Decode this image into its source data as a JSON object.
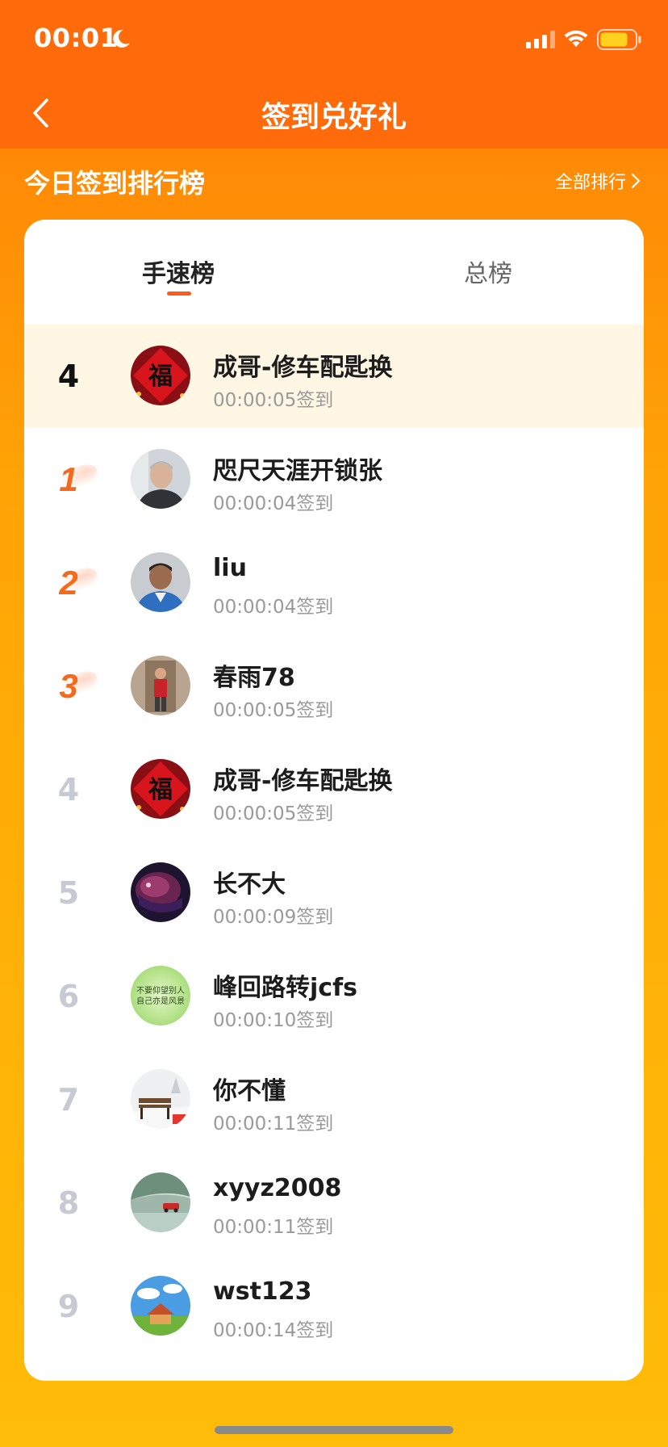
{
  "status_bar": {
    "time": "00:01",
    "battery_color": "#ffd21f"
  },
  "nav": {
    "title": "签到兑好礼"
  },
  "section": {
    "title": "今日签到排行榜",
    "all_rank_label": "全部排行"
  },
  "tabs": [
    {
      "label": "手速榜",
      "active": true
    },
    {
      "label": "总榜",
      "active": false
    }
  ],
  "colors": {
    "accent": "#ff6a0a",
    "medal": "#f46a1c",
    "highlight_row": "#fff7e3"
  },
  "rows": [
    {
      "rank": "4",
      "name": "成哥-修车配匙换",
      "time": "00:00:05签到",
      "avatar": "fu-icon"
    },
    {
      "rank": "1",
      "name": "咫尺天涯开锁张",
      "time": "00:00:04签到",
      "avatar": "photo"
    },
    {
      "rank": "2",
      "name": "liu",
      "time": "00:00:04签到",
      "avatar": "photo"
    },
    {
      "rank": "3",
      "name": "春雨78",
      "time": "00:00:05签到",
      "avatar": "photo"
    },
    {
      "rank": "4",
      "name": "成哥-修车配匙换",
      "time": "00:00:05签到",
      "avatar": "fu-icon"
    },
    {
      "rank": "5",
      "name": "长不大",
      "time": "00:00:09签到",
      "avatar": "photo"
    },
    {
      "rank": "6",
      "name": "峰回路转jcfs",
      "time": "00:00:10签到",
      "avatar": "text-image"
    },
    {
      "rank": "7",
      "name": "你不懂",
      "time": "00:00:11签到",
      "avatar": "photo"
    },
    {
      "rank": "8",
      "name": "xyyz2008",
      "time": "00:00:11签到",
      "avatar": "photo"
    },
    {
      "rank": "9",
      "name": "wst123",
      "time": "00:00:14签到",
      "avatar": "photo"
    }
  ],
  "avatar_text": {
    "line1": "不要仰望别人",
    "line2": "自己亦是风景"
  }
}
